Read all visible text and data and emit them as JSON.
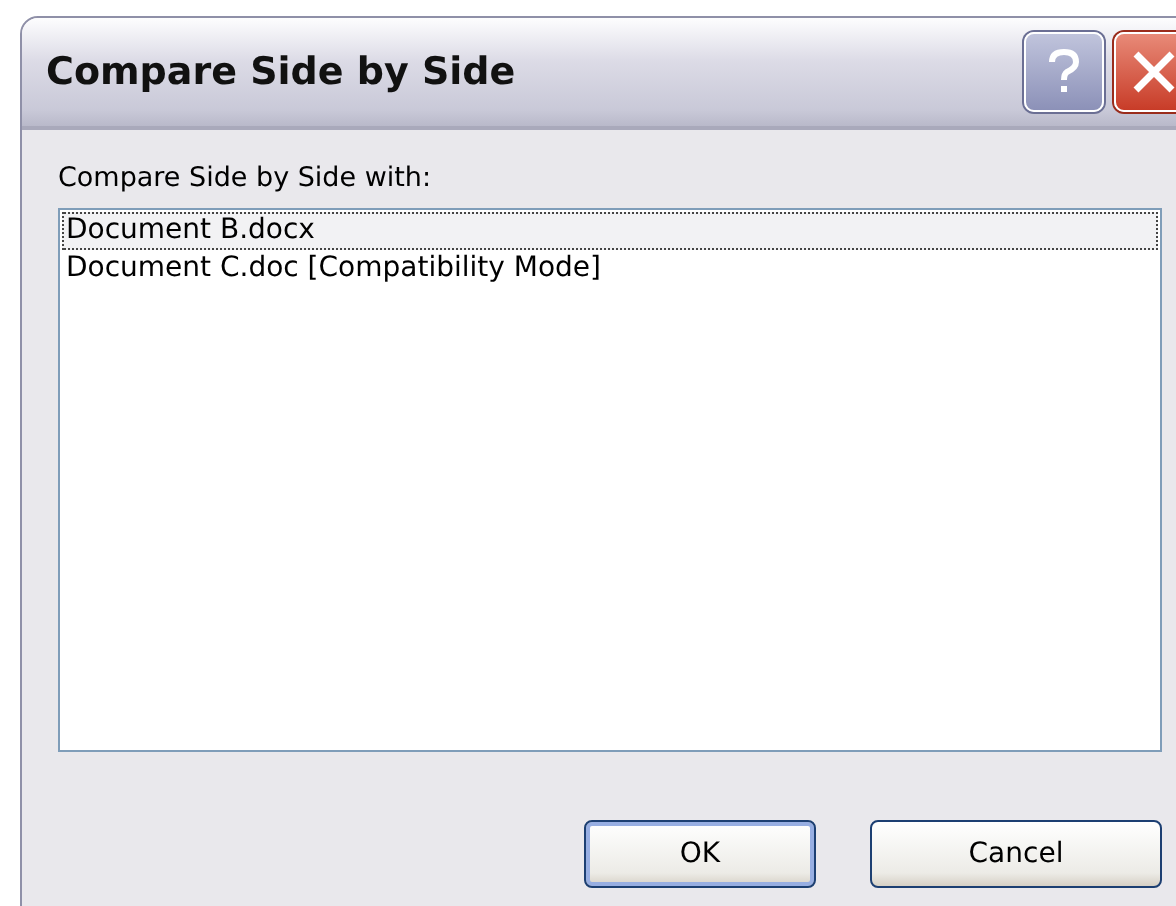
{
  "window": {
    "title": "Compare Side by Side"
  },
  "prompt": "Compare Side by Side with:",
  "documents": [
    {
      "name": "Document B.docx",
      "selected": true
    },
    {
      "name": "Document C.doc [Compatibility Mode]",
      "selected": false
    }
  ],
  "buttons": [
    {
      "label": "OK",
      "kind": "default"
    },
    {
      "label": "Cancel",
      "kind": "normal"
    }
  ]
}
